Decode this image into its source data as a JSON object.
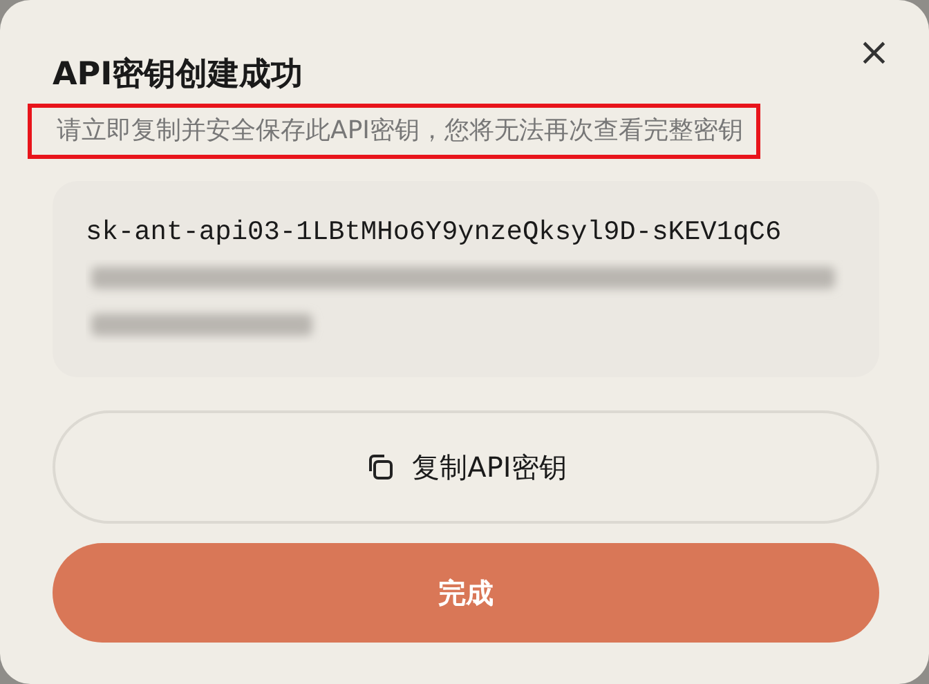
{
  "dialog": {
    "title": "API密钥创建成功",
    "subtitle": "请立即复制并安全保存此API密钥，您将无法再次查看完整密钥",
    "subtitle_highlighted": true,
    "key_visible": "sk-ant-api03-1LBtMHo6Y9ynzeQksyl9D-sKEV1qC6",
    "copy_button": "复制API密钥",
    "done_button": "完成",
    "close": "×"
  }
}
